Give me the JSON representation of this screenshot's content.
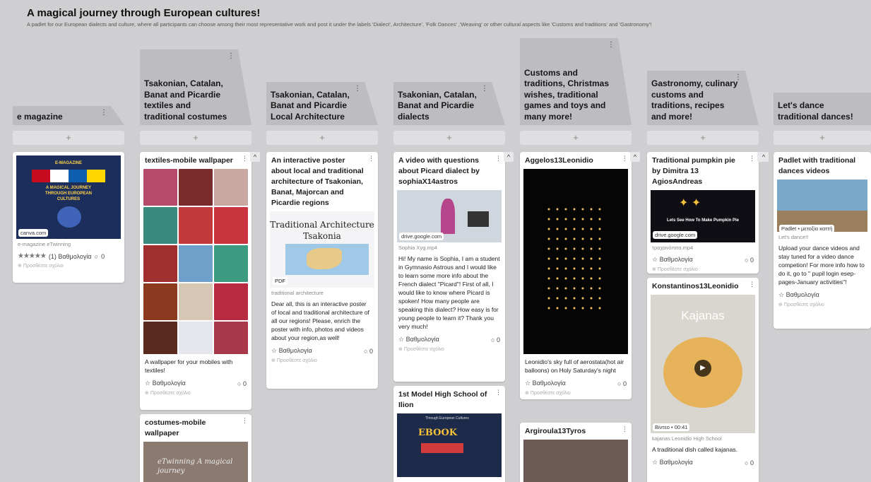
{
  "header": {
    "title": "A magical journey through European cultures!",
    "description": "A padlet for our European dialects and culture, where all participants can choose among their most representative work and post it under the labels 'Dialect', Architecture', 'Folk Dances' ,'Weaving' or other cultural aspects like 'Customs and traditions' and 'Gastronomy'!"
  },
  "ui": {
    "add": "+",
    "menu": "⋮",
    "scroll_up": "^",
    "rate": "Βαθμολογία",
    "add_comment": "Προσθέστε σχόλιο",
    "comment_count": "0"
  },
  "columns": [
    {
      "title": "e magazine",
      "cards": [
        {
          "image_title": "E-MAGAZINE",
          "image_subtitle": "A MAGICAL JOURNEY THROUGH EUROPEAN CULTURES",
          "source": "canva.com",
          "meta": "e-magazine eTwinning",
          "rating_stars": "★★★★★",
          "rating_text": "(1) Βαθμολογία"
        }
      ]
    },
    {
      "title": "Tsakonian, Catalan, Banat and Picardie textiles and traditional costumes",
      "cards": [
        {
          "title": "textiles-mobile wallpaper",
          "body": "A wallpaper for your mobiles with textiles!"
        },
        {
          "title": "costumes-mobile wallpaper",
          "image_text": "eTwinning A magical journey"
        }
      ]
    },
    {
      "title": "Tsakonian, Catalan, Banat and Picardie Local Architecture",
      "cards": [
        {
          "title": "An interactive poster about local and traditional architecture of Tsakonian, Banat, Majorcan and Picardie regions",
          "image_title": "Traditional Architecture",
          "image_subtitle": "Tsakonia",
          "badge": "PDF",
          "meta": "traditional architecture",
          "body": "Dear all, this is an interactive poster of local and traditional architecture of all our regions! Please, enrich the poster with info, photos and videos about your region,as well!"
        }
      ]
    },
    {
      "title": "Tsakonian, Catalan, Banat and Picardie dialects",
      "cards": [
        {
          "title": "A video with questions about Picard dialect by sophiaX14astros",
          "source": "drive.google.com",
          "meta": "Sophia Xyg.mp4",
          "body": "Hi! My name is Sophia, I am a student in Gymnasio Astrous and I would like to learn some more info about the French dialect \"Picard\"! First of all, I would like to know where Picard is spoken! How many people are speaking this dialect? How easy is for young people to learn it? Thank you very much!"
        },
        {
          "title": "1st Model High School of Ilion",
          "image_title": "EBOOK",
          "image_subtitle": "Through European Cultures"
        }
      ]
    },
    {
      "title": "Customs and traditions, Christmas wishes, traditional games and toys and many more!",
      "cards": [
        {
          "title": "Aggelos13Leonidio",
          "body": "Leonidio's sky full of aerostata(hot air balloons) on Holy Saturday's night"
        },
        {
          "title": "Argiroula13Tyros"
        }
      ]
    },
    {
      "title": "Gastronomy, culinary customs and traditions, recipes and more!",
      "cards": [
        {
          "title": "Traditional pumpkin pie by Dimitra 13 AgiosAndreas",
          "image_text": "Lets See How To Make Pumpkin Pie",
          "source": "drive.google.com",
          "meta": "τραχανόπιτα.mp4"
        },
        {
          "title": "Konstantinos13Leonidio",
          "image_text": "Kajanas",
          "badge": "Βίντεο • 00:41",
          "meta": "kajanas Leonidio High School",
          "body": "A traditional dish called kajanas."
        }
      ]
    },
    {
      "title": "Let's dance traditional dances!",
      "cards": [
        {
          "title": "Padlet with traditional dances videos",
          "source": "Padlet • μετοξία καττή",
          "meta": "Let's dance!!",
          "body": "Upload your dance videos and stay tuned for a video dance competion! For more info how to do it, go to \" pupil login esep-pages-January activities\"!"
        }
      ]
    }
  ]
}
